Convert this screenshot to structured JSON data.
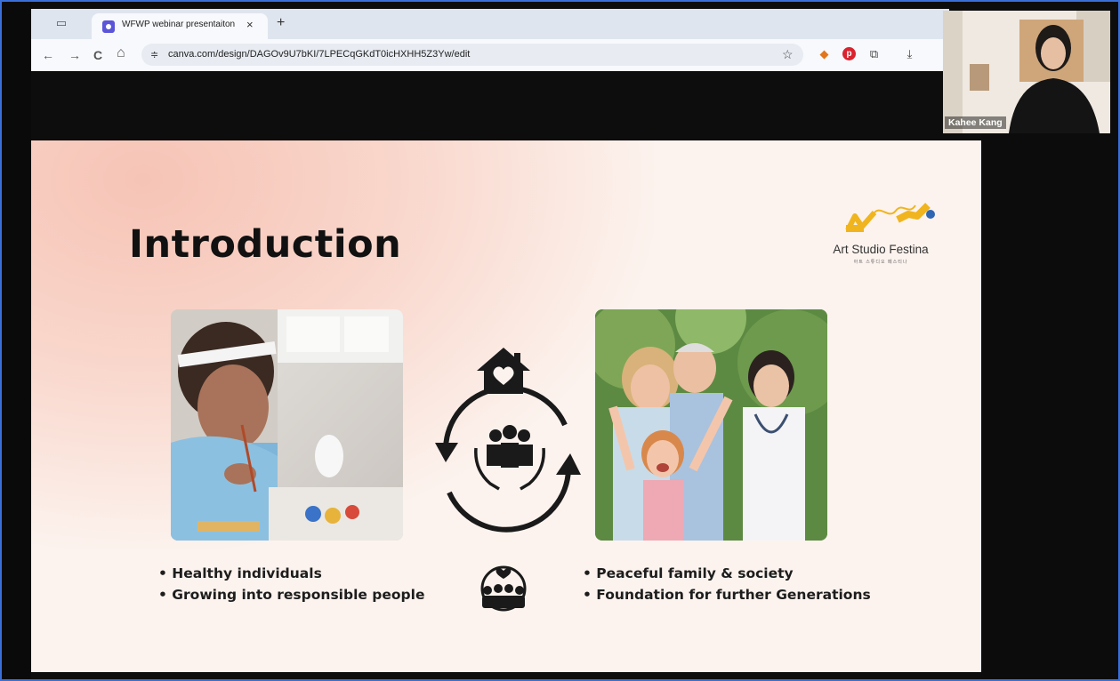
{
  "browser": {
    "tab_title": "WFWP webinar presentaiton",
    "tab_close": "×",
    "new_tab": "+",
    "url": "canva.com/design/DAGOv9U7bKI/7LPECqGKdT0icHXHH5Z3Yw/edit",
    "nav": {
      "back": "←",
      "forward": "→",
      "reload": "C",
      "home": "⌂"
    },
    "site_info_icon": "tune-icon",
    "bookmark_icon": "star-icon",
    "extensions": [
      "metamask-icon",
      "pinterest-icon",
      "puzzle-icon",
      "download-icon"
    ]
  },
  "slide": {
    "title": "Introduction",
    "logo": {
      "name": "Art Studio Festina",
      "subtitle": "아트 스튜디오 페스티나",
      "colors": [
        "#f0b41e",
        "#2f66b3"
      ]
    },
    "bullets_left": [
      "• Healthy individuals",
      "• Growing into responsible people"
    ],
    "bullets_right": [
      "• Peaceful family & society",
      "• Foundation for further Generations"
    ],
    "icons": [
      "house-heart-icon",
      "cycle-arrows-icon",
      "family-in-hands-icon",
      "community-globe-icon"
    ]
  },
  "webcam": {
    "participant_name": "Kahee Kang"
  },
  "colors": {
    "accent_frame": "#3a6fd8",
    "slide_bg": "#fcf3ee",
    "slide_glow": "#f6c4b6"
  }
}
